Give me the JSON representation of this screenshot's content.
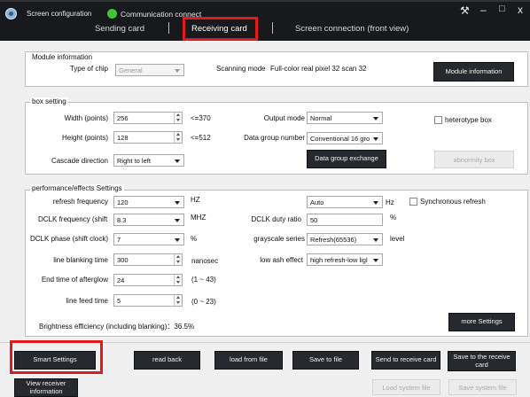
{
  "title_bar": {
    "app_title": "Screen configuration",
    "status_text": "Communication connect",
    "tabs": [
      "Sending card",
      "Receiving card",
      "Screen connection (front view)"
    ],
    "window_controls": {
      "tools": "⚒",
      "minimize": "–",
      "maximize": "□",
      "close": "x"
    }
  },
  "module_info": {
    "group_title": "Module information",
    "chip_label": "Type of chip",
    "chip_value": "General",
    "scanning_label": "Scanning mode",
    "scanning_value": "Full-color real pixel 32 scan 32",
    "module_info_button": "Module information"
  },
  "box_setting": {
    "group_title": "box setting",
    "width_label": "Width (points)",
    "width_value": "256",
    "width_limit": "<=370",
    "height_label": "Height (points)",
    "height_value": "128",
    "height_limit": "<=512",
    "cascade_label": "Cascade direction",
    "cascade_value": "Right to left",
    "output_mode_label": "Output mode",
    "output_mode_value": "Normal",
    "data_group_label": "Data group number",
    "data_group_value": "Conventional 16 gro",
    "heterotype_label": "heterotype box",
    "data_group_exchange_button": "Data group exchange",
    "abnormity_box_button": "abnormity box"
  },
  "performance": {
    "group_title": "performance/effects Settings",
    "refresh_label": "refresh frequency",
    "refresh_value": "120",
    "refresh_unit": "HZ",
    "refresh_mode_value": "Auto",
    "refresh_mode_unit": "Hz",
    "sync_refresh_label": "Synchronous refresh",
    "dclk_freq_label": "DCLK frequency (shift",
    "dclk_freq_value": "8.3",
    "dclk_freq_unit": "MHZ",
    "dclk_duty_label": "DCLK duty ratio",
    "dclk_duty_value": "50",
    "dclk_duty_unit": "%",
    "dclk_phase_label": "DCLK phase (shift clock)",
    "dclk_phase_value": "7",
    "dclk_phase_unit": "%",
    "grayscale_label": "grayscale series",
    "grayscale_value": "Refresh(65536)",
    "grayscale_unit": "level",
    "line_blank_label": "line blanking time",
    "line_blank_value": "300",
    "line_blank_unit": "nanosec",
    "low_ash_label": "low ash effect",
    "low_ash_value": "high refresh-low ligl",
    "afterglow_label": "End time of afterglow",
    "afterglow_value": "24",
    "afterglow_range": "(1 ~ 43)",
    "line_feed_label": "line feed time",
    "line_feed_value": "5",
    "line_feed_range": "(0 ~ 23)",
    "brightness_text": "Brightness efficiency (including blanking)：36.5%",
    "more_settings_button": "more Settings"
  },
  "footer": {
    "smart_settings": "Smart Settings",
    "read_back": "read back",
    "load_from_file": "load from file",
    "save_to_file": "Save to file",
    "send_to_receive_card": "Send to receive card",
    "save_to_receive_card": "Save to the receive card",
    "view_receiver_info": "View receiver information",
    "load_system_file": "Load system file",
    "save_system_file": "Save system file"
  },
  "colors": {
    "title_bar": "#17191c",
    "dark_button": "#26292d",
    "highlight": "#e01b1b",
    "status_dot": "#45c23a"
  }
}
